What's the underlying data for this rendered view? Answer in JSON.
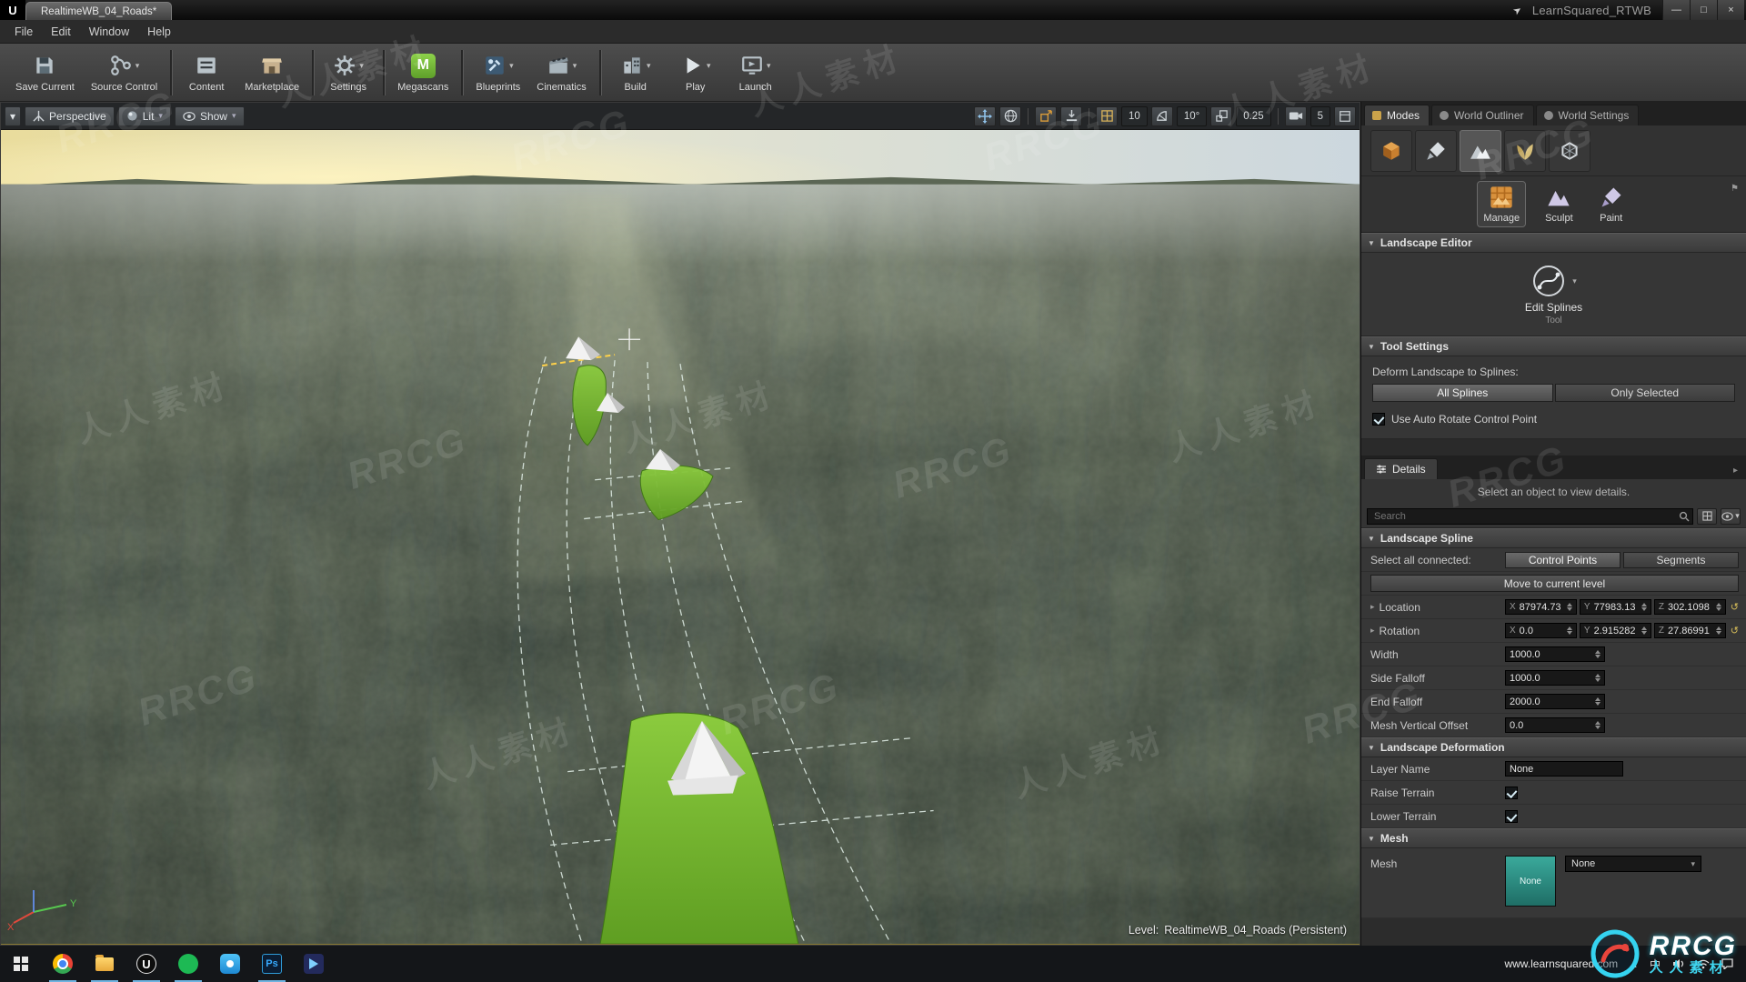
{
  "glyphs": {
    "caret_down": "▾",
    "caret_right": "▸",
    "section_down": "▼",
    "minimize": "—",
    "maximize": "□",
    "close": "×",
    "chevron_up": "∧",
    "reset": "↺",
    "u_logo": "U",
    "ime": "中",
    "feedback_arrow": "➤"
  },
  "titlebar": {
    "doc_tab": "RealtimeWB_04_Roads*",
    "app_title": "LearnSquared_RTWB"
  },
  "menubar": {
    "items": [
      {
        "label": "File"
      },
      {
        "label": "Edit"
      },
      {
        "label": "Window"
      },
      {
        "label": "Help"
      }
    ]
  },
  "toolbar": {
    "megascans_letter": "M",
    "items": [
      {
        "label": "Save Current"
      },
      {
        "label": "Source Control"
      },
      {
        "label": "Content"
      },
      {
        "label": "Marketplace"
      },
      {
        "label": "Settings"
      },
      {
        "label": "Megascans"
      },
      {
        "label": "Blueprints"
      },
      {
        "label": "Cinematics"
      },
      {
        "label": "Build"
      },
      {
        "label": "Play"
      },
      {
        "label": "Launch"
      }
    ]
  },
  "viewport_bar": {
    "perspective": "Perspective",
    "lit": "Lit",
    "show": "Show",
    "grid_snap": "10",
    "angle_snap": "10°",
    "scale_snap": "0.25",
    "camera_speed": "5"
  },
  "viewport": {
    "level_label": "Level:",
    "level_name": "RealtimeWB_04_Roads (Persistent)",
    "axis_x": "X",
    "axis_y": "Y"
  },
  "modes": {
    "tabs": [
      {
        "label": "Modes"
      },
      {
        "label": "World Outliner"
      },
      {
        "label": "World Settings"
      }
    ],
    "sub_modes": [
      {
        "label": "Manage"
      },
      {
        "label": "Sculpt"
      },
      {
        "label": "Paint"
      }
    ],
    "landscape_editor_title": "Landscape Editor",
    "tool_name": "Edit Splines",
    "tool_caption": "Tool",
    "tool_settings_title": "Tool Settings",
    "deform_label": "Deform Landscape to Splines:",
    "all_splines": "All Splines",
    "only_selected": "Only Selected",
    "auto_rotate_label": "Use Auto Rotate Control Point",
    "auto_rotate_checked": true
  },
  "details": {
    "tab": "Details",
    "hint": "Select an object to view details.",
    "search_placeholder": "Search",
    "spline_title": "Landscape Spline",
    "select_all_label": "Select all connected:",
    "btn_control_points": "Control Points",
    "btn_segments": "Segments",
    "btn_move": "Move to current level",
    "axis": {
      "x": "X",
      "y": "Y",
      "z": "Z"
    },
    "location": {
      "label": "Location",
      "x": "87974.73",
      "y": "77983.13",
      "z": "302.1098"
    },
    "rotation": {
      "label": "Rotation",
      "x": "0.0",
      "y": "2.915282",
      "z": "27.86991"
    },
    "width": {
      "label": "Width",
      "value": "1000.0"
    },
    "side_falloff": {
      "label": "Side Falloff",
      "value": "1000.0"
    },
    "end_falloff": {
      "label": "End Falloff",
      "value": "2000.0"
    },
    "mesh_offset": {
      "label": "Mesh Vertical Offset",
      "value": "0.0"
    },
    "deform_title": "Landscape Deformation",
    "layer_name_label": "Layer Name",
    "layer_name_value": "None",
    "raise_label": "Raise Terrain",
    "raise_checked": true,
    "lower_label": "Lower Terrain",
    "lower_checked": true,
    "mesh_title": "Mesh",
    "mesh_label": "Mesh",
    "mesh_thumb": "None",
    "mesh_value": "None"
  },
  "taskbar": {
    "url": "www.learnsquared.com",
    "photoshop": "Ps"
  },
  "watermark": {
    "a": "RRCG",
    "b": "人人素材",
    "logo_text": "RRCG",
    "logo_sub": "人人素材"
  },
  "colors": {
    "spline_green": "#74b82f",
    "megascans_green": "#6fae38",
    "thumb_teal": "#2e8f86",
    "accent_orange": "#c87f2f"
  }
}
